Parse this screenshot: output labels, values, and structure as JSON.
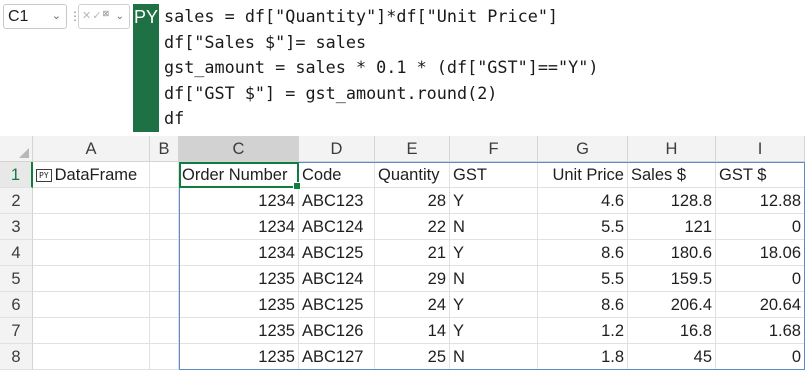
{
  "formula_bar": {
    "name_box": "C1",
    "python_badge": "PY",
    "code_lines": [
      "sales = df[\"Quantity\"]*df[\"Unit Price\"]",
      "df[\"Sales $\"]= sales",
      "gst_amount = sales * 0.1 * (df[\"GST\"]==\"Y\")",
      "df[\"GST $\"] = gst_amount.round(2)",
      "df"
    ]
  },
  "sheet": {
    "columns": [
      "A",
      "B",
      "C",
      "D",
      "E",
      "F",
      "G",
      "H",
      "I"
    ],
    "selected_column": "C",
    "row_numbers": [
      "1",
      "2",
      "3",
      "4",
      "5",
      "6",
      "7",
      "8"
    ],
    "selected_row": "1",
    "a1_icon": "PY",
    "a1_label": "DataFrame",
    "headers": [
      "Order Number",
      "Code",
      "Quantity",
      "GST",
      "Unit Price",
      "Sales $",
      "GST $"
    ],
    "rows": [
      [
        "1234",
        "ABC123",
        "28",
        "Y",
        "4.6",
        "128.8",
        "12.88"
      ],
      [
        "1234",
        "ABC124",
        "22",
        "N",
        "5.5",
        "121",
        "0"
      ],
      [
        "1234",
        "ABC125",
        "21",
        "Y",
        "8.6",
        "180.6",
        "18.06"
      ],
      [
        "1235",
        "ABC124",
        "29",
        "N",
        "5.5",
        "159.5",
        "0"
      ],
      [
        "1235",
        "ABC125",
        "24",
        "Y",
        "8.6",
        "206.4",
        "20.64"
      ],
      [
        "1235",
        "ABC126",
        "14",
        "Y",
        "1.2",
        "16.8",
        "1.68"
      ],
      [
        "1235",
        "ABC127",
        "25",
        "N",
        "1.8",
        "45",
        "0"
      ]
    ]
  },
  "colors": {
    "python_green": "#1e7145",
    "selection_green": "#107c41",
    "spill_border": "#5b8bc9"
  }
}
